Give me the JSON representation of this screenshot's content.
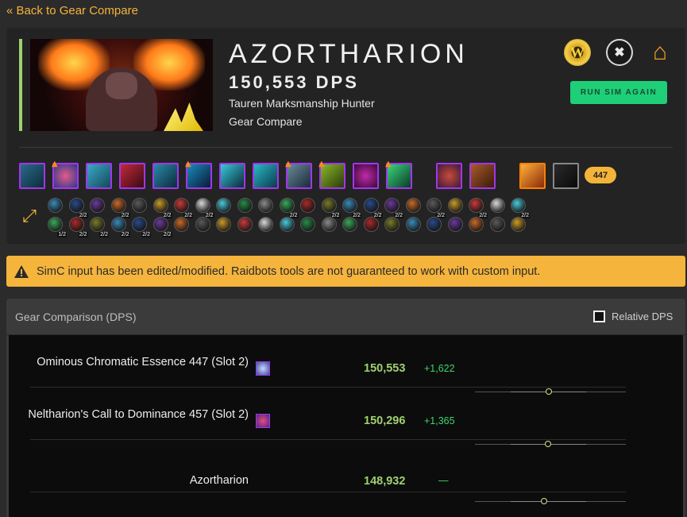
{
  "nav": {
    "back_label": "« Back to Gear Compare"
  },
  "character": {
    "name": "AZORTHARION",
    "dps_label": "150,553 DPS",
    "spec": "Tauren Marksmanship Hunter",
    "report_type": "Gear Compare",
    "accent_color": "#9fd16f"
  },
  "header_icons": [
    "wow-armory-icon",
    "warcraft-logs-icon",
    "raider-io-icon"
  ],
  "actions": {
    "run_sim_label": "RUN SIM AGAIN",
    "button_color": "#1ecf78"
  },
  "gear": {
    "item_level": "447"
  },
  "warning": {
    "text": "SimC input has been edited/modified. Raidbots tools are not guaranteed to work with custom input.",
    "color": "#f5b43c"
  },
  "comparison": {
    "title": "Gear Comparison (DPS)",
    "relative_label": "Relative DPS",
    "relative_checked": false,
    "rows": [
      {
        "name": "Ominous Chromatic Essence 447 (Slot 2)",
        "dps": "150,553",
        "delta": "+1,622",
        "icon": "chromatic-essence-icon"
      },
      {
        "name": "Neltharion's Call to Dominance 457 (Slot 2)",
        "dps": "150,296",
        "delta": "+1,365",
        "icon": "neltharion-call-icon"
      },
      {
        "name": "Azortharion",
        "dps": "148,932",
        "delta": "—",
        "icon": ""
      }
    ]
  },
  "talent_ranks": [
    "2/2",
    "2/2",
    "2/2",
    "2/2",
    "2/2",
    "2/2",
    "2/2",
    "2/2",
    "2/2",
    "2/2",
    "2/2",
    "2/2",
    "2/2",
    "1/2",
    "2/2",
    "2/2",
    "2/2",
    "2/2",
    "2/2"
  ]
}
